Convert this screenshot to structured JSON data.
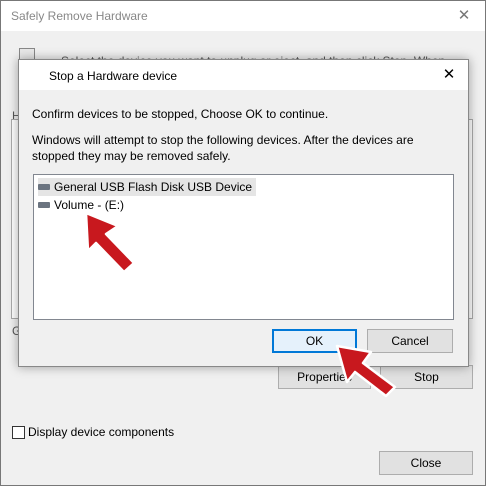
{
  "background_window": {
    "title": "Safely Remove Hardware",
    "close_glyph": "✕",
    "instruction_text": "Select the device you want to unplug or eject, and then click Stop. When",
    "hardware_label_fragment": "H",
    "group_label_fragment": "G",
    "properties_button": "Properties",
    "stop_button": "Stop",
    "display_components_label": "Display device components",
    "close_button": "Close"
  },
  "dialog": {
    "title": "Stop a Hardware device",
    "close_glyph": "✕",
    "confirm_text": "Confirm devices to be stopped, Choose OK to continue.",
    "warning_line1": "Windows will attempt to stop the following devices. After the devices are",
    "warning_line2": "stopped they may be removed safely.",
    "devices": [
      {
        "label": "General USB Flash Disk USB Device",
        "icon": "usb-drive-icon",
        "selected": true
      },
      {
        "label": "Volume - (E:)",
        "icon": "volume-drive-icon",
        "selected": false
      }
    ],
    "ok_button": "OK",
    "cancel_button": "Cancel"
  },
  "colors": {
    "annotation_arrow": "#c8181e",
    "ok_focus_border": "#0078d7",
    "window_bg": "#f0f0f0"
  }
}
